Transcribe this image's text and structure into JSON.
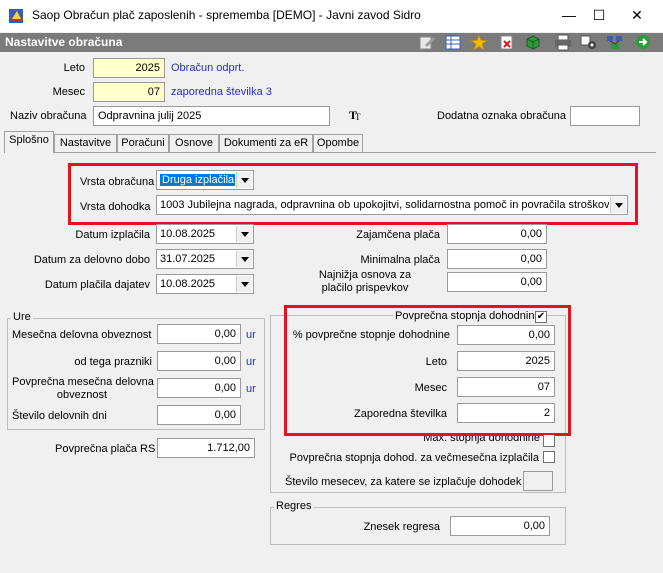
{
  "window": {
    "title": "Saop Obračun plač zaposlenih - sprememba [DEMO] - Javni zavod Sidro",
    "minimize": "—",
    "maximize": "☐",
    "close": "✕"
  },
  "header": {
    "title": "Nastavitve obračuna",
    "toolbar_icons": [
      "edit-icon",
      "table-icon",
      "star-icon",
      "delete-icon",
      "cube-icon",
      "print-icon",
      "settings-icon",
      "exit-icon"
    ]
  },
  "top": {
    "leto_label": "Leto",
    "leto_value": "2025",
    "leto_link": "Obračun odprt.",
    "mesec_label": "Mesec",
    "mesec_value": "07",
    "mesec_link": "zaporedna številka 3",
    "naziv_label": "Naziv obračuna",
    "naziv_value": "Odpravnina julij 2025",
    "dodatna_label": "Dodatna oznaka obračuna",
    "dodatna_value": ""
  },
  "tabs": [
    "Splošno",
    "Nastavitve",
    "Poračuni",
    "Osnove",
    "Dokumenti za eR",
    "Opombe"
  ],
  "general": {
    "vrsta_obracuna_label": "Vrsta obračuna",
    "vrsta_obracuna_value": "Druga izplačila",
    "vrsta_dohodka_label": "Vrsta dohodka",
    "vrsta_dohodka_value": "1003  Jubilejna nagrada, odpravnina ob upokojitvi, solidarnostna pomoč in povračila stroškov",
    "datum_izplacila_label": "Datum izplačila",
    "datum_izplacila_value": "10.08.2025",
    "datum_delovno_label": "Datum za delovno dobo",
    "datum_delovno_value": "31.07.2025",
    "datum_placila_label": "Datum plačila dajatev",
    "datum_placila_value": "10.08.2025",
    "zajamcena_label": "Zajamčena plača",
    "zajamcena_value": "0,00",
    "minimalna_label": "Minimalna plača",
    "minimalna_value": "0,00",
    "najnizja_label_1": "Najnižja osnova za",
    "najnizja_label_2": "plačilo prispevkov",
    "najnizja_value": "0,00"
  },
  "ure": {
    "title": "Ure",
    "mesecna_label": "Mesečna delovna obveznost",
    "mesecna_value": "0,00",
    "prazniki_label": "od tega prazniki",
    "prazniki_value": "0,00",
    "povprecna_label_1": "Povprečna mesečna delovna",
    "povprecna_label_2": "obveznost",
    "povprecna_value": "0,00",
    "dni_label": "Število delovnih dni",
    "dni_value": "0,00",
    "unit": "ur"
  },
  "placa_rs": {
    "label": "Povprečna plača RS",
    "value": "1.712,00"
  },
  "stopnja": {
    "title": "Povprečna stopnja dohodnine",
    "title_checked": "✔",
    "pct_label": "% povprečne stopnje dohodnine",
    "pct_value": "0,00",
    "leto_label": "Leto",
    "leto_value": "2025",
    "mesec_label": "Mesec",
    "mesec_value": "07",
    "zap_label": "Zaporedna številka",
    "zap_value": "2",
    "max_label": "Max. stopnja dohodnine",
    "vecmesecna_label": "Povprečna stopnja dohod. za večmesečna izplačila",
    "stevilo_label": "Število mesecev, za katere se izplačuje dohodek",
    "stevilo_value": ""
  },
  "regres": {
    "title": "Regres",
    "znesek_label": "Znesek regresa",
    "znesek_value": "0,00"
  }
}
